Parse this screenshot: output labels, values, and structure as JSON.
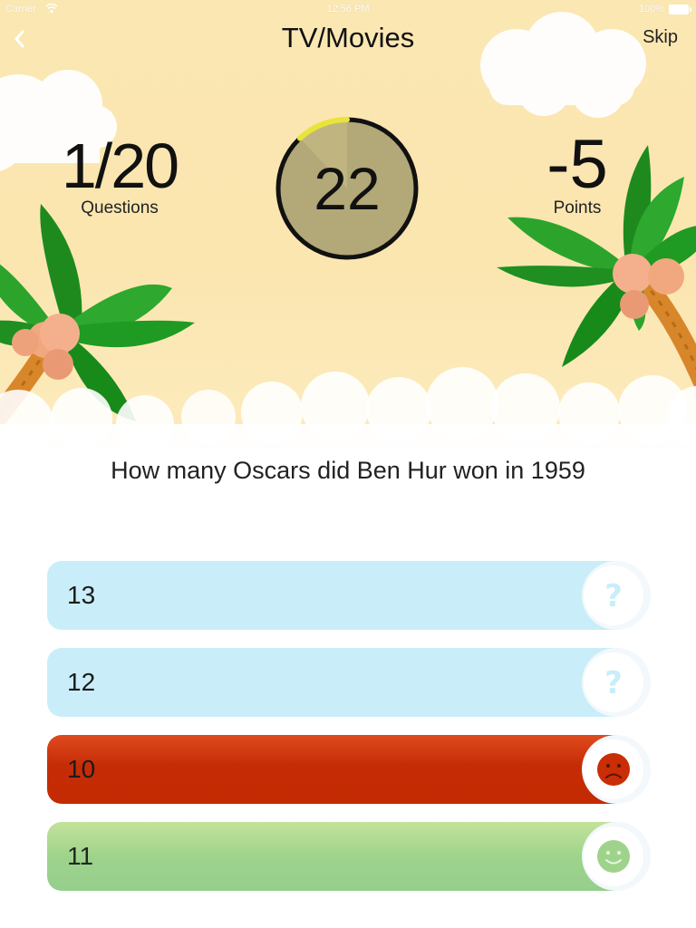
{
  "status_bar": {
    "carrier": "Carrier",
    "time": "12:56 PM",
    "battery": "100%"
  },
  "nav": {
    "title": "TV/Movies",
    "skip_label": "Skip"
  },
  "stats": {
    "questions_value": "1/20",
    "questions_label": "Questions",
    "points_value": "-5",
    "points_label": "Points"
  },
  "timer": {
    "value": "22",
    "progress": 0.12
  },
  "question": {
    "text": "How many Oscars did Ben Hur won in 1959"
  },
  "answers": [
    {
      "label": "13",
      "state": "neutral",
      "icon": "question-mark-icon"
    },
    {
      "label": "12",
      "state": "neutral",
      "icon": "question-mark-icon"
    },
    {
      "label": "10",
      "state": "wrong",
      "icon": "sad-face-icon"
    },
    {
      "label": "11",
      "state": "right",
      "icon": "happy-face-icon"
    }
  ],
  "colors": {
    "scene_background": "#fbe7b2",
    "neutral_answer": "#c9eef9",
    "wrong_answer": "#c52c06",
    "right_answer": "#9fd38c",
    "timer_fill": "#b2a878",
    "timer_progress": "#e8e43a"
  }
}
